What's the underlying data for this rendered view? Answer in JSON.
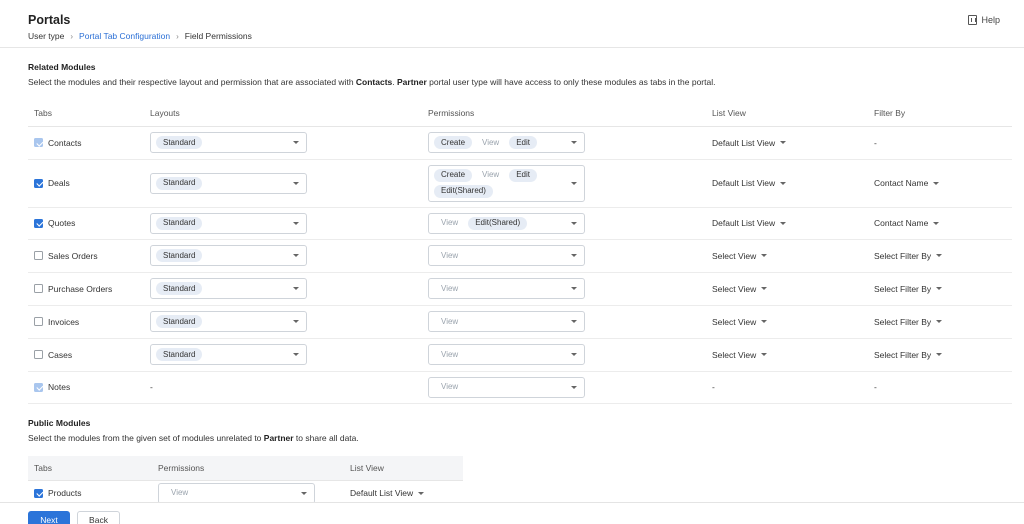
{
  "header": {
    "title": "Portals",
    "breadcrumb": {
      "item1": "User type",
      "item2": "Portal Tab Configuration",
      "item3": "Field Permissions"
    },
    "help": "Help"
  },
  "related": {
    "title": "Related Modules",
    "desc_1": "Select the modules and their respective layout and permission that are associated with ",
    "desc_bold1": "Contacts",
    "desc_2": ". ",
    "desc_bold2": "Partner",
    "desc_3": " portal user type will have access to only these modules as tabs in the portal.",
    "columns": {
      "tabs": "Tabs",
      "layouts": "Layouts",
      "permissions": "Permissions",
      "list_view": "List View",
      "filter_by": "Filter By"
    },
    "rows": [
      {
        "tab": "Contacts",
        "checked": "disabled",
        "layout": "Standard",
        "permissions": [
          {
            "label": "Create",
            "active": true
          },
          {
            "label": "View",
            "active": false
          },
          {
            "label": "Edit",
            "active": true
          }
        ],
        "list_view": "Default List View",
        "filter_by": "-"
      },
      {
        "tab": "Deals",
        "checked": "checked",
        "layout": "Standard",
        "permissions": [
          {
            "label": "Create",
            "active": true
          },
          {
            "label": "View",
            "active": false
          },
          {
            "label": "Edit",
            "active": true
          },
          {
            "label": "Edit(Shared)",
            "active": true
          }
        ],
        "list_view": "Default List View",
        "filter_by": "Contact Name"
      },
      {
        "tab": "Quotes",
        "checked": "checked",
        "layout": "Standard",
        "permissions": [
          {
            "label": "View",
            "active": false
          },
          {
            "label": "Edit(Shared)",
            "active": true
          }
        ],
        "list_view": "Default List View",
        "filter_by": "Contact Name"
      },
      {
        "tab": "Sales Orders",
        "checked": "unchecked",
        "layout": "Standard",
        "permissions": [
          {
            "label": "View",
            "active": false
          }
        ],
        "list_view": "Select View",
        "filter_by": "Select Filter By"
      },
      {
        "tab": "Purchase Orders",
        "checked": "unchecked",
        "layout": "Standard",
        "permissions": [
          {
            "label": "View",
            "active": false
          }
        ],
        "list_view": "Select View",
        "filter_by": "Select Filter By"
      },
      {
        "tab": "Invoices",
        "checked": "unchecked",
        "layout": "Standard",
        "permissions": [
          {
            "label": "View",
            "active": false
          }
        ],
        "list_view": "Select View",
        "filter_by": "Select Filter By"
      },
      {
        "tab": "Cases",
        "checked": "unchecked",
        "layout": "Standard",
        "permissions": [
          {
            "label": "View",
            "active": false
          }
        ],
        "list_view": "Select View",
        "filter_by": "Select Filter By"
      },
      {
        "tab": "Notes",
        "checked": "disabled",
        "layout": "-",
        "permissions": [
          {
            "label": "View",
            "active": false
          }
        ],
        "list_view": "-",
        "filter_by": "-"
      }
    ]
  },
  "public": {
    "title": "Public Modules",
    "desc_1": "Select the modules from the given set of modules unrelated to ",
    "desc_bold": "Partner",
    "desc_2": " to share all data.",
    "columns": {
      "tabs": "Tabs",
      "permissions": "Permissions",
      "list_view": "List View"
    },
    "rows": [
      {
        "tab": "Products",
        "checked": "checked",
        "permissions": [
          {
            "label": "View",
            "active": false
          }
        ],
        "list_view": "Default List View"
      }
    ]
  },
  "footer": {
    "next": "Next",
    "back": "Back"
  },
  "colors": {
    "accent": "#2b74d9",
    "link": "#2a6fd6",
    "pill": "#e6ecf5"
  }
}
